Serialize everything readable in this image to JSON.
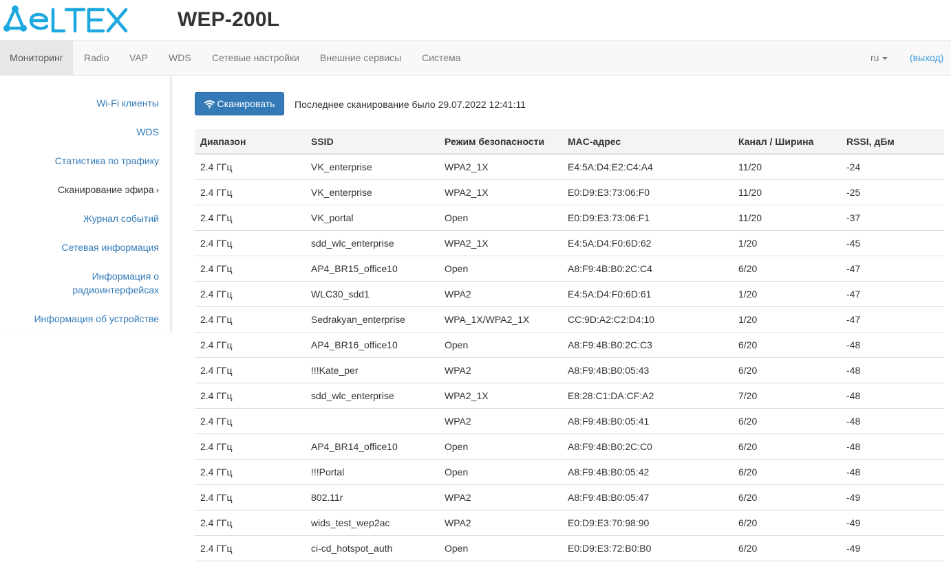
{
  "brand": {
    "logo_text": "ELTEX",
    "logo_color": "#1ea8e0",
    "device_model": "WEP-200L"
  },
  "nav": {
    "items": [
      {
        "label": "Мониторинг",
        "active": true
      },
      {
        "label": "Radio",
        "active": false
      },
      {
        "label": "VAP",
        "active": false
      },
      {
        "label": "WDS",
        "active": false
      },
      {
        "label": "Сетевые настройки",
        "active": false
      },
      {
        "label": "Внешние сервисы",
        "active": false
      },
      {
        "label": "Система",
        "active": false
      }
    ],
    "language": "ru",
    "logout": "(выход)"
  },
  "sidebar": {
    "items": [
      {
        "label": "Wi-Fi клиенты"
      },
      {
        "label": "WDS"
      },
      {
        "label": "Статистика по трафику"
      },
      {
        "label": "Сканирование эфира",
        "current": true
      },
      {
        "label": "Журнал событий"
      },
      {
        "label": "Сетевая информация"
      },
      {
        "label_line1": "Информация о",
        "label_line2": "радиоинтерфейсах"
      },
      {
        "label": "Информация об устройстве"
      }
    ]
  },
  "scan": {
    "button_label": "Сканировать",
    "last_scan_text": "Последнее сканирование было 29.07.2022 12:41:11"
  },
  "table": {
    "columns": [
      "Диапазон",
      "SSID",
      "Режим безопасности",
      "MAC-адрес",
      "Канал / Ширина",
      "RSSI, дБм"
    ],
    "rows": [
      [
        "2.4 ГГц",
        "VK_enterprise",
        "WPA2_1X",
        "E4:5A:D4:E2:C4:A4",
        "11/20",
        "-24"
      ],
      [
        "2.4 ГГц",
        "VK_enterprise",
        "WPA2_1X",
        "E0:D9:E3:73:06:F0",
        "11/20",
        "-25"
      ],
      [
        "2.4 ГГц",
        "VK_portal",
        "Open",
        "E0:D9:E3:73:06:F1",
        "11/20",
        "-37"
      ],
      [
        "2.4 ГГц",
        "sdd_wlc_enterprise",
        "WPA2_1X",
        "E4:5A:D4:F0:6D:62",
        "1/20",
        "-45"
      ],
      [
        "2.4 ГГц",
        "AP4_BR15_office10",
        "Open",
        "A8:F9:4B:B0:2C:C4",
        "6/20",
        "-47"
      ],
      [
        "2.4 ГГц",
        "WLC30_sdd1",
        "WPA2",
        "E4:5A:D4:F0:6D:61",
        "1/20",
        "-47"
      ],
      [
        "2.4 ГГц",
        "Sedrakyan_enterprise",
        "WPA_1X/WPA2_1X",
        "CC:9D:A2:C2:D4:10",
        "1/20",
        "-47"
      ],
      [
        "2.4 ГГц",
        "AP4_BR16_office10",
        "Open",
        "A8:F9:4B:B0:2C:C3",
        "6/20",
        "-48"
      ],
      [
        "2.4 ГГц",
        "!!!Kate_per",
        "WPA2",
        "A8:F9:4B:B0:05:43",
        "6/20",
        "-48"
      ],
      [
        "2.4 ГГц",
        "sdd_wlc_enterprise",
        "WPA2_1X",
        "E8:28:C1:DA:CF:A2",
        "7/20",
        "-48"
      ],
      [
        "2.4 ГГц",
        "",
        "WPA2",
        "A8:F9:4B:B0:05:41",
        "6/20",
        "-48"
      ],
      [
        "2.4 ГГц",
        "AP4_BR14_office10",
        "Open",
        "A8:F9:4B:B0:2C:C0",
        "6/20",
        "-48"
      ],
      [
        "2.4 ГГц",
        "!!!Portal",
        "Open",
        "A8:F9:4B:B0:05:42",
        "6/20",
        "-48"
      ],
      [
        "2.4 ГГц",
        "802.11r",
        "WPA2",
        "A8:F9:4B:B0:05:47",
        "6/20",
        "-49"
      ],
      [
        "2.4 ГГц",
        "wids_test_wep2ac",
        "WPA2",
        "E0:D9:E3:70:98:90",
        "6/20",
        "-49"
      ],
      [
        "2.4 ГГц",
        "ci-cd_hotspot_auth",
        "Open",
        "E0:D9:E3:72:B0:B0",
        "6/20",
        "-49"
      ]
    ]
  }
}
